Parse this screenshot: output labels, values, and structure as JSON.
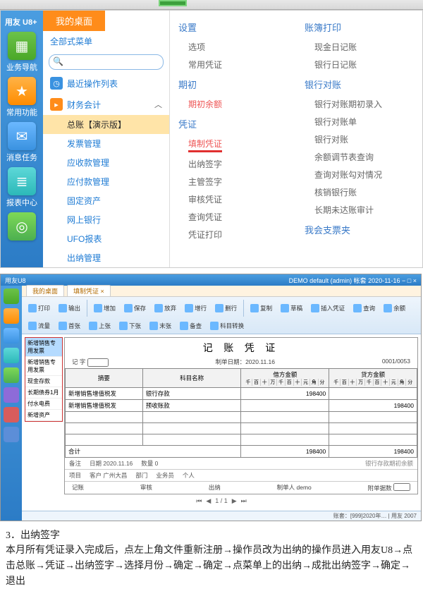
{
  "header": {
    "logo": "用友 U8+"
  },
  "rail": [
    {
      "label": "业务导航"
    },
    {
      "label": "常用功能"
    },
    {
      "label": "消息任务"
    },
    {
      "label": "报表中心"
    },
    {
      "label": ""
    }
  ],
  "my_desk_tab": "我的桌面",
  "all_menu_link": "全部式菜单",
  "search_placeholder": "",
  "recent_ops": "最近操作列表",
  "fin_acct": "财务会计",
  "sub_items": [
    "总账【演示版】",
    "发票管理",
    "应收款管理",
    "应付款管理",
    "固定资产",
    "网上银行",
    "UFO报表",
    "出纳管理"
  ],
  "right": {
    "col1": {
      "g1": {
        "title": "设置",
        "items": [
          "选项",
          "常用凭证"
        ]
      },
      "g2": {
        "title": "期初",
        "items": [
          "期初余额"
        ]
      },
      "g3": {
        "title": "凭证",
        "items": [
          "填制凭证",
          "出纳签字",
          "主管签字",
          "审核凭证",
          "查询凭证",
          "凭证打印"
        ]
      }
    },
    "col2": {
      "g1": {
        "title": "账簿打印",
        "items": [
          "现金日记账",
          "银行日记账"
        ]
      },
      "g2": {
        "title": "银行对账",
        "items": [
          "银行对账期初录入",
          "银行对账单",
          "银行对账",
          "余额调节表查询",
          "查询对账勾对情况",
          "核销银行账",
          "长期未达账审计"
        ]
      },
      "g3": {
        "title": "我会支票夹",
        "items": []
      }
    }
  },
  "app2": {
    "title_left": "用友U8",
    "title_right": "DEMO default (admin) 帐套 2020-11-16 − □ ×",
    "tabs": [
      "我的桌面",
      "填制凭证 ×"
    ],
    "ribbon_groups": [
      [
        "打印",
        "输出"
      ],
      [
        "增加",
        "保存",
        "放弃",
        "增行",
        "删行"
      ],
      [
        "复制",
        "草稿",
        "插入凭证",
        "查询",
        "余额",
        "流量",
        "首张",
        "上张",
        "下张",
        "末张",
        "备查",
        "科目转换"
      ]
    ],
    "side_list": [
      "新增销售专用发票",
      "新增销售专用发票",
      "现金存款",
      "长期债券1月",
      "付水电费",
      "新增资产"
    ],
    "doc": {
      "title": "记 账 凭 证",
      "head_left": "记 字",
      "head_date_lbl": "制单日期：",
      "head_date": "2020.11.16",
      "head_no": "0001/0053",
      "th_summary": "摘要",
      "th_subject": "科目名称",
      "th_debit": "借方金额",
      "th_credit": "贷方金额",
      "row1_sum": "新增销售增值税发",
      "row1_subj": "银行存款",
      "row2_sum": "新增销售增值税发",
      "row2_subj": "预收账款",
      "total_lbl": "合计",
      "foot_date": "日期 2020.11.16",
      "foot_no": "数量 0",
      "proj_lbl": "项目",
      "dept_lbl": "部门",
      "person_lbl": "个人",
      "remark_lbl": "备注",
      "cust_lbl": "客户 广州大昌",
      "ywn_lbl": "业务员",
      "maker": "制单人 demo",
      "attach": "附单据数",
      "reviewer": "审核",
      "cashier": "出纳",
      "approver": "记账"
    },
    "status": "账套：[999]2020年… | 用友 2007"
  },
  "article": {
    "heading": "3．出纳签字",
    "body": "本月所有凭证录入完成后，点左上角文件重新注册→操作员改为出纳的操作员进入用友U8→点击总账→凭证→出纳签字→选择月份→确定→确定→点菜单上的出纳→成批出纳签字→确定→退出"
  }
}
